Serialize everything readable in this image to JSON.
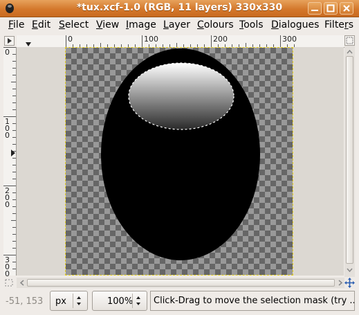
{
  "window": {
    "title": "*tux.xcf-1.0 (RGB, 11 layers) 330x330"
  },
  "menu": [
    {
      "label": "File",
      "hotkey": "F",
      "rest": "ile"
    },
    {
      "label": "Edit",
      "hotkey": "E",
      "rest": "dit"
    },
    {
      "label": "Select",
      "hotkey": "S",
      "rest": "elect"
    },
    {
      "label": "View",
      "hotkey": "V",
      "rest": "iew"
    },
    {
      "label": "Image",
      "hotkey": "I",
      "rest": "mage"
    },
    {
      "label": "Layer",
      "hotkey": "L",
      "rest": "ayer"
    },
    {
      "label": "Colours",
      "hotkey": "C",
      "rest": "olours"
    },
    {
      "label": "Tools",
      "hotkey": "T",
      "rest": "ools"
    },
    {
      "label": "Dialogues",
      "hotkey": "D",
      "rest": "ialogues"
    },
    {
      "label": "Filters",
      "hotkey": "r",
      "pre": "Filte",
      "rest": "s"
    }
  ],
  "ruler": {
    "horizontal_labels": [
      "0",
      "100",
      "200",
      "300"
    ],
    "vertical_labels": [
      [
        "0"
      ],
      [
        "1",
        "0",
        "0"
      ],
      [
        "2",
        "0",
        "0"
      ],
      [
        "3",
        "0",
        "0"
      ]
    ]
  },
  "status": {
    "pointer_coords": "-51, 153",
    "unit": "px",
    "zoom": "100%",
    "message": "Click-Drag to move the selection mask (try ..."
  },
  "colors": {
    "titlebar": "#d4782c",
    "selection_guide": "#e8d21a",
    "shape_fill": "#000000"
  },
  "icons": {
    "window": "gimp-eye-icon",
    "minimize": "minimize-icon",
    "maximize": "maximize-icon",
    "close": "close-icon",
    "menu_arrow": "image-menu-arrow-icon",
    "quick_mask": "quick-mask-icon",
    "zoom_fit": "zoom-fit-icon",
    "navigate": "navigate-icon"
  }
}
